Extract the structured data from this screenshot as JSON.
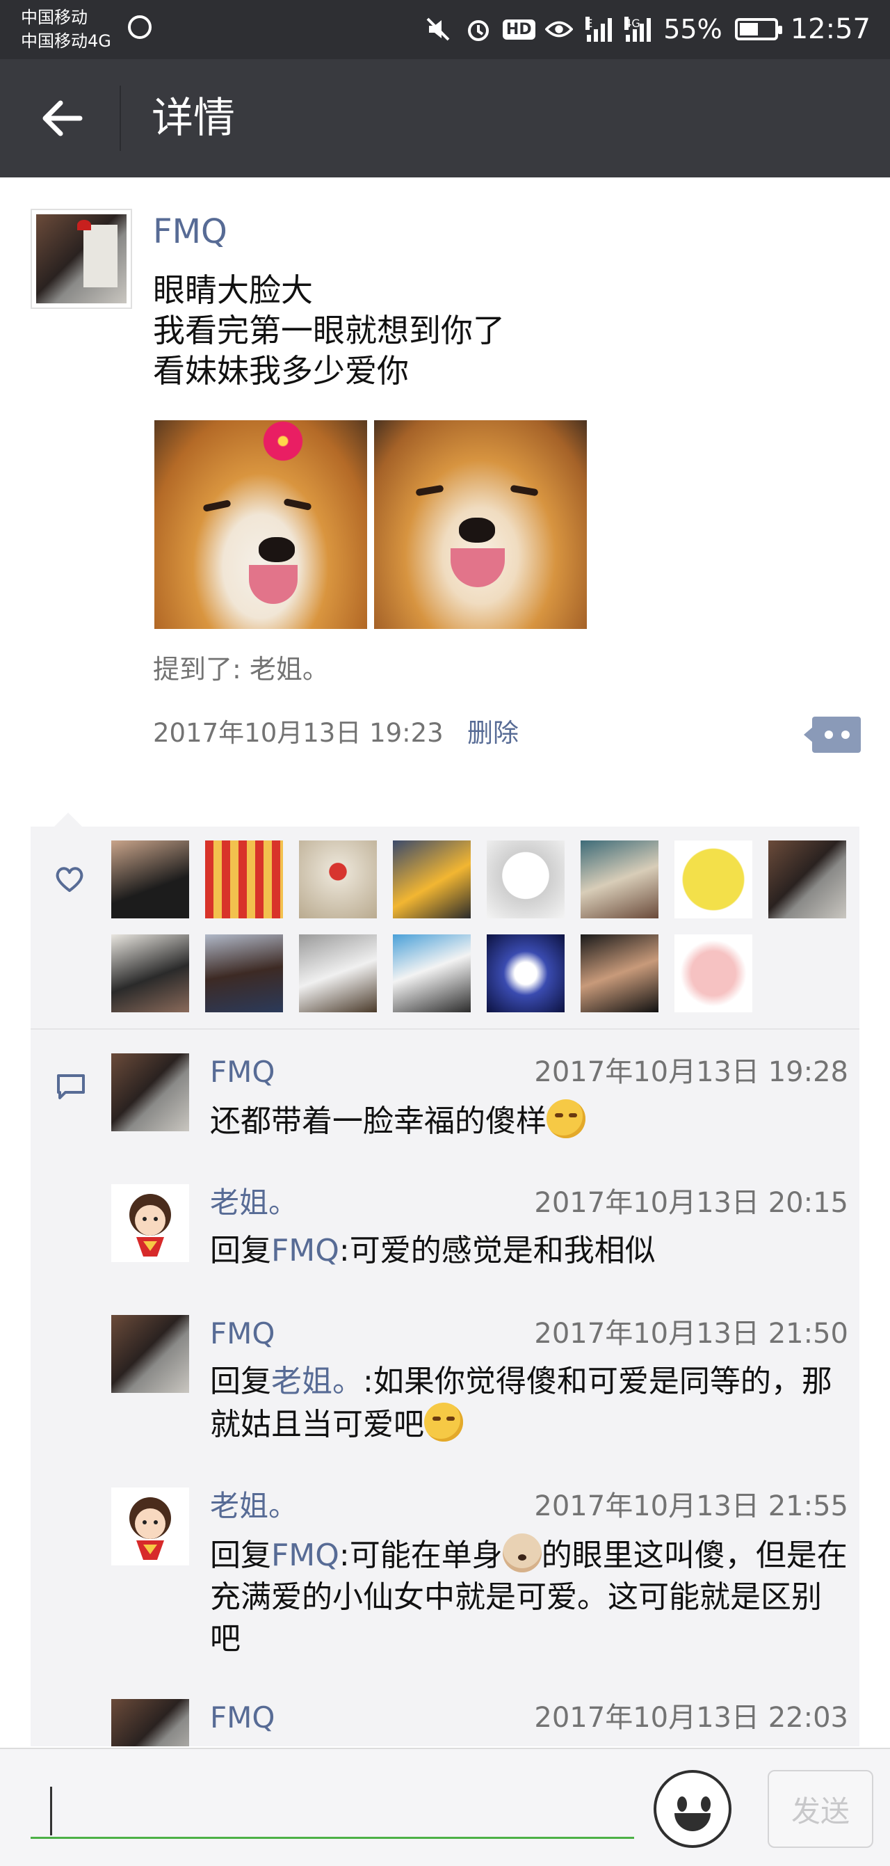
{
  "status_bar": {
    "carrier_1": "中国移动",
    "carrier_2": "中国移动4G",
    "network_tag_1": "E",
    "network_tag_2": "4G",
    "hd_label": "HD",
    "battery_percent": "55%",
    "battery_level": 0.55,
    "time": "12:57",
    "icons": [
      "sync-icon",
      "mute-icon",
      "alarm-icon",
      "hd-icon",
      "eye-icon",
      "signal-icon",
      "signal-icon",
      "battery-icon"
    ]
  },
  "header": {
    "title": "详情",
    "back_icon": "arrow-left-icon"
  },
  "post": {
    "author": "FMQ",
    "text_lines": [
      "眼睛大脸大",
      "我看完第一眼就想到你了",
      "看妹妹我多少爱你"
    ],
    "mention": "提到了:  老姐。",
    "timestamp": "2017年10月13日 19:23",
    "delete_label": "删除",
    "more_icon": "more-dots-icon"
  },
  "likes": {
    "icon": "heart-icon",
    "avatar_count": 15
  },
  "comments": {
    "icon": "comment-icon",
    "items": [
      {
        "name": "FMQ",
        "time": "2017年10月13日 19:28",
        "reply_prefix": "",
        "reply_target": "",
        "text": "还都带着一脸幸福的傻样",
        "emoji": "smirk"
      },
      {
        "name": "老姐。",
        "time": "2017年10月13日 20:15",
        "reply_prefix": "回复",
        "reply_target": "FMQ",
        "text": ":可爱的感觉是和我相似",
        "emoji": ""
      },
      {
        "name": "FMQ",
        "time": "2017年10月13日 21:50",
        "reply_prefix": "回复",
        "reply_target": "老姐。",
        "text": ":如果你觉得傻和可爱是同等的，那就姑且当可爱吧",
        "emoji": "smirk"
      },
      {
        "name": "老姐。",
        "time": "2017年10月13日 21:55",
        "reply_prefix": "回复",
        "reply_target": "FMQ",
        "text_before_emoji": ":可能在单身",
        "text_after_emoji": "的眼里这叫傻，但是在充满爱的小仙女中就是可爱。这可能就是区别吧",
        "emoji": "dog"
      },
      {
        "name": "FMQ",
        "time": "2017年10月13日 22:03"
      }
    ]
  },
  "input_bar": {
    "placeholder": "",
    "emoji_icon": "smiley-icon",
    "send_label": "发送"
  }
}
